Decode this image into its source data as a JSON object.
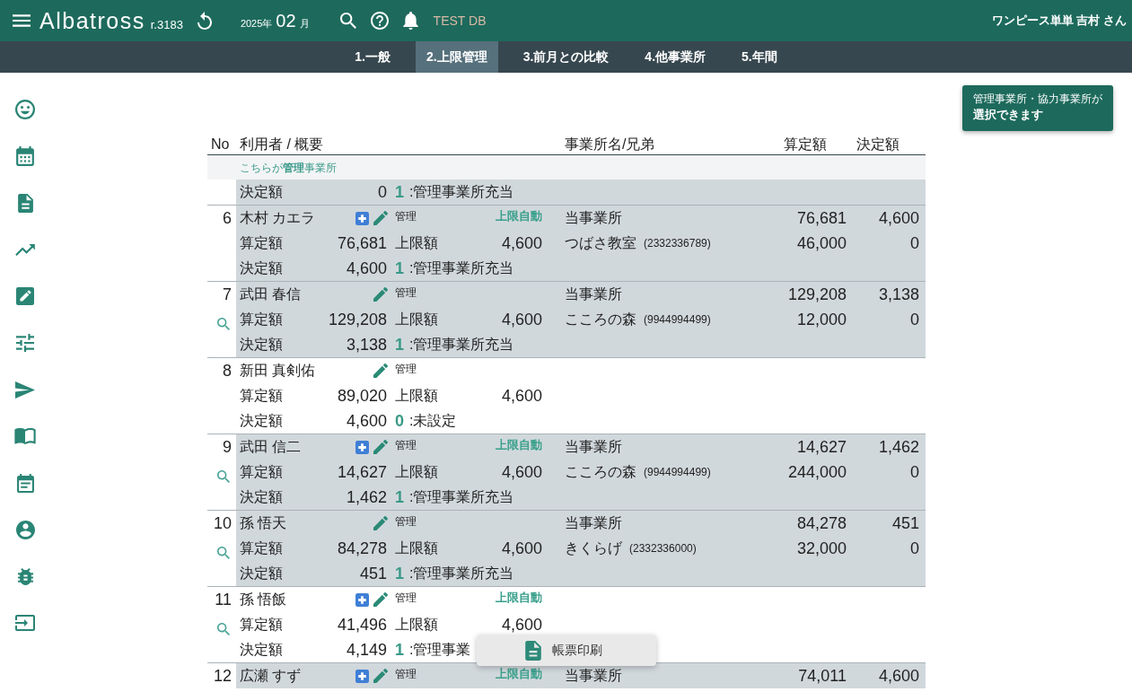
{
  "header": {
    "logo": "Albatross",
    "revision": "r.3183",
    "period": {
      "year": "2025年",
      "month": "02",
      "unit": "月"
    },
    "database": "TEST DB",
    "user": "ワンピース単単 吉村 さん"
  },
  "tabs": [
    {
      "label": "1.一般",
      "selected": false
    },
    {
      "label": "2.上限管理",
      "selected": true
    },
    {
      "label": "3.前月との比較",
      "selected": false
    },
    {
      "label": "4.他事業所",
      "selected": false
    },
    {
      "label": "5.年間",
      "selected": false
    }
  ],
  "notice": {
    "caption": "管理事業所・協力事業所が",
    "message": "選択できます"
  },
  "table": {
    "columns": [
      "No",
      "利用者 / 概要",
      "事業所名/兄弟",
      "算定額",
      "決定額"
    ],
    "summary": {
      "caption": "こちらが**管理**事業所",
      "decided_label": "決定額",
      "decided": "0",
      "code": "1",
      "code_text": ":管理事業所充当"
    },
    "rows": [
      {
        "no": "6",
        "name": "木村 カエラ",
        "add_icon": true,
        "search_icon": false,
        "shaded": true,
        "role": "管理",
        "auto_limit": "上限自動",
        "calc_label": "算定額",
        "calc": "76,681",
        "limit_label": "上限額",
        "limit": "4,600",
        "decided_label": "決定額",
        "decided": "4,600",
        "code": "1",
        "code_text": ":管理事業所充当",
        "offices": [
          {
            "name": "当事業所",
            "calc": "76,681",
            "decided": "4,600"
          },
          {
            "name": "つばさ教室",
            "number": "(2332336789)",
            "calc": "46,000",
            "decided": "0"
          }
        ]
      },
      {
        "no": "7",
        "name": "武田 春信",
        "add_icon": false,
        "search_icon": true,
        "shaded": true,
        "role": "管理",
        "calc_label": "算定額",
        "calc": "129,208",
        "limit_label": "上限額",
        "limit": "4,600",
        "decided_label": "決定額",
        "decided": "3,138",
        "code": "1",
        "code_text": ":管理事業所充当",
        "offices": [
          {
            "name": "当事業所",
            "calc": "129,208",
            "decided": "3,138"
          },
          {
            "name": "こころの森",
            "number": "(9944994499)",
            "calc": "12,000",
            "decided": "0"
          }
        ]
      },
      {
        "no": "8",
        "name": "新田 真剣佑",
        "add_icon": false,
        "search_icon": false,
        "shaded": false,
        "role": "管理",
        "calc_label": "算定額",
        "calc": "89,020",
        "limit_label": "上限額",
        "limit": "4,600",
        "decided_label": "決定額",
        "decided": "4,600",
        "code": "0",
        "code_text": ":未設定"
      },
      {
        "no": "9",
        "name": "武田 信二",
        "add_icon": true,
        "search_icon": true,
        "shaded": true,
        "role": "管理",
        "auto_limit": "上限自動",
        "calc_label": "算定額",
        "calc": "14,627",
        "limit_label": "上限額",
        "limit": "4,600",
        "decided_label": "決定額",
        "decided": "1,462",
        "code": "1",
        "code_text": ":管理事業所充当",
        "offices": [
          {
            "name": "当事業所",
            "calc": "14,627",
            "decided": "1,462"
          },
          {
            "name": "こころの森",
            "number": "(9944994499)",
            "calc": "244,000",
            "decided": "0"
          }
        ]
      },
      {
        "no": "10",
        "name": "孫 悟天",
        "add_icon": false,
        "search_icon": true,
        "shaded": true,
        "role": "管理",
        "calc_label": "算定額",
        "calc": "84,278",
        "limit_label": "上限額",
        "limit": "4,600",
        "decided_label": "決定額",
        "decided": "451",
        "code": "1",
        "code_text": ":管理事業所充当",
        "offices": [
          {
            "name": "当事業所",
            "calc": "84,278",
            "decided": "451"
          },
          {
            "name": "きくらげ",
            "number": "(2332336000)",
            "calc": "32,000",
            "decided": "0"
          }
        ]
      },
      {
        "no": "11",
        "name": "孫 悟飯",
        "add_icon": true,
        "search_icon": true,
        "shaded": false,
        "role": "管理",
        "auto_limit": "上限自動",
        "calc_label": "算定額",
        "calc": "41,496",
        "limit_label": "上限額",
        "limit": "4,600",
        "decided_label": "決定額",
        "decided": "4,149",
        "code": "1",
        "code_text": ":管理事業"
      },
      {
        "no": "12",
        "name": "広瀬 すず",
        "add_icon": true,
        "search_icon": false,
        "shaded": true,
        "role": "管理",
        "auto_limit": "上限自動",
        "offices": [
          {
            "name": "当事業所",
            "calc": "74,011",
            "decided": "4,600"
          }
        ]
      }
    ]
  },
  "context_menu": {
    "items": [
      {
        "label": "帳票印刷"
      }
    ]
  }
}
